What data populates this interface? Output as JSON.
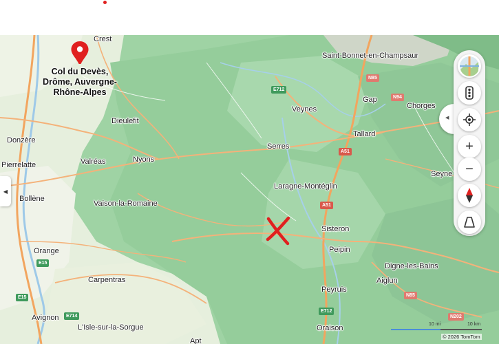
{
  "map": {
    "places": [
      {
        "name": "Crest"
      },
      {
        "name": "Saint-Bonnet-en-Champsaur"
      },
      {
        "name": "Veynes"
      },
      {
        "name": "Gap"
      },
      {
        "name": "Chorges"
      },
      {
        "name": "Dieulefit"
      },
      {
        "name": "Tallard"
      },
      {
        "name": "Donzère"
      },
      {
        "name": "Serres"
      },
      {
        "name": "Pierrelatte"
      },
      {
        "name": "Valréas"
      },
      {
        "name": "Nyons"
      },
      {
        "name": "Seyne"
      },
      {
        "name": "Laragne-Montéglin"
      },
      {
        "name": "Bollène"
      },
      {
        "name": "Vaison-la-Romaine"
      },
      {
        "name": "Sisteron"
      },
      {
        "name": "Orange"
      },
      {
        "name": "Peipin"
      },
      {
        "name": "Digne-les-Bains"
      },
      {
        "name": "Carpentras"
      },
      {
        "name": "Aiglun"
      },
      {
        "name": "Peyruis"
      },
      {
        "name": "Avignon"
      },
      {
        "name": "L'Isle-sur-la-Sorgue"
      },
      {
        "name": "Oraison"
      },
      {
        "name": "Apt"
      }
    ],
    "road_shields": [
      {
        "text": "E712",
        "kind": "e"
      },
      {
        "text": "N85",
        "kind": "n"
      },
      {
        "text": "N94",
        "kind": "n"
      },
      {
        "text": "A51",
        "kind": "a"
      },
      {
        "text": "A51",
        "kind": "a"
      },
      {
        "text": "E15",
        "kind": "e"
      },
      {
        "text": "E15",
        "kind": "e"
      },
      {
        "text": "E714",
        "kind": "e"
      },
      {
        "text": "E712",
        "kind": "e"
      },
      {
        "text": "N85",
        "kind": "n"
      },
      {
        "text": "N202",
        "kind": "n"
      }
    ],
    "pin": {
      "label": "Col du Devès, Drôme, Auvergne-Rhône-Alpes",
      "color": "#e0201f"
    },
    "marker": {
      "symbol": "X",
      "color": "#e0201f"
    },
    "scale": {
      "left_label": "10 mi",
      "right_label": "10 km"
    },
    "copyright": "© 2026 TomTom"
  },
  "controls": {
    "zoom_in": "+",
    "zoom_out": "−"
  }
}
